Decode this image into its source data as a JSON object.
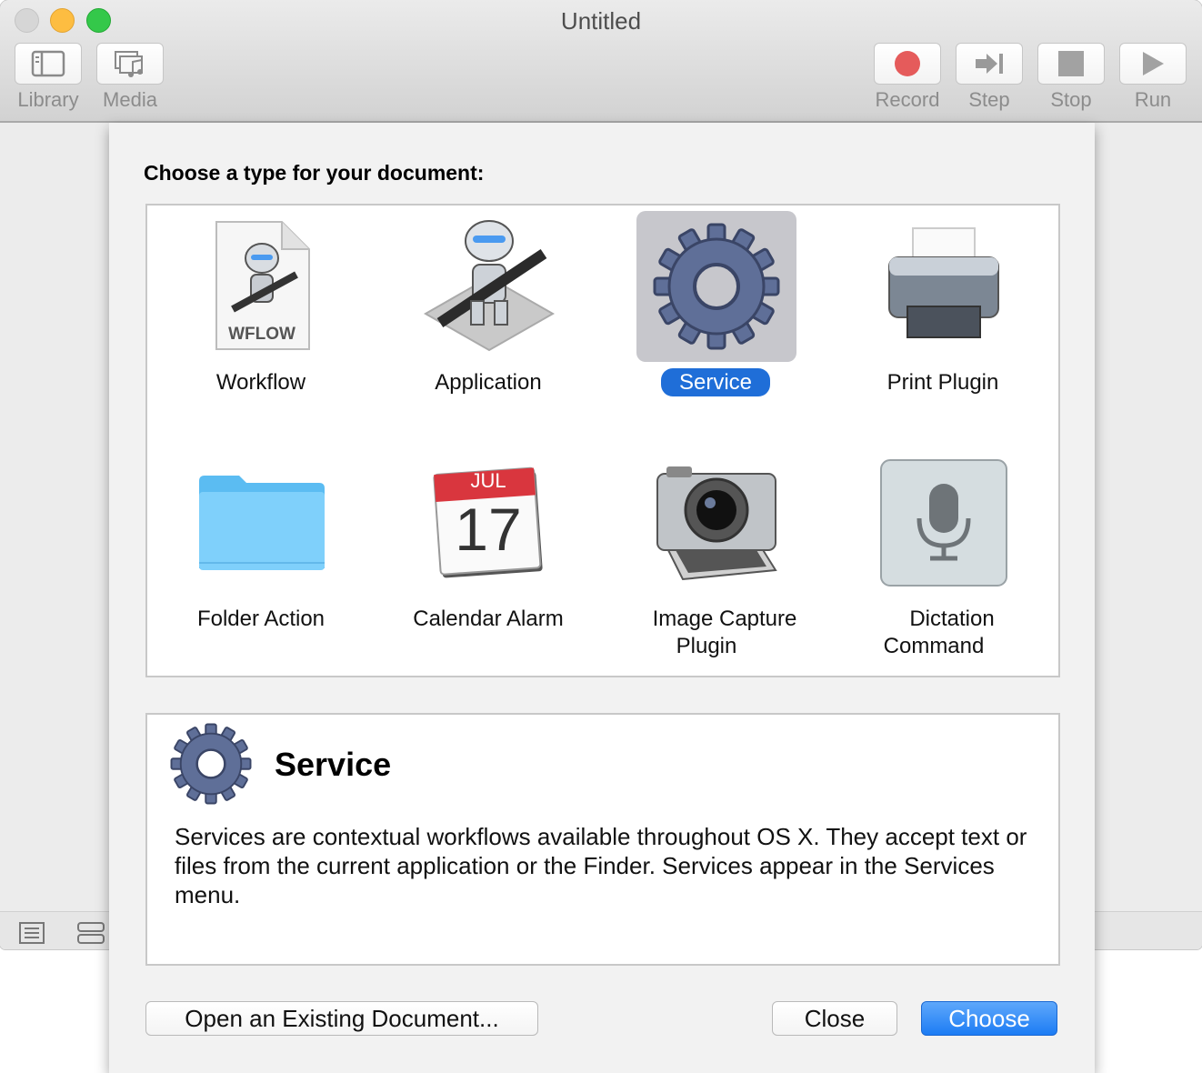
{
  "window": {
    "title": "Untitled"
  },
  "toolbar": {
    "library": "Library",
    "media": "Media",
    "record": "Record",
    "step": "Step",
    "stop": "Stop",
    "run": "Run"
  },
  "sheet": {
    "heading": "Choose a type for your document:",
    "types": [
      {
        "label": "Workflow",
        "icon": "workflow-document-icon",
        "badge": "WFLOW"
      },
      {
        "label": "Application",
        "icon": "automator-robot-icon"
      },
      {
        "label": "Service",
        "icon": "gear-icon",
        "selected": true
      },
      {
        "label": "Print Plugin",
        "icon": "printer-icon"
      },
      {
        "label": "Folder Action",
        "icon": "folder-icon"
      },
      {
        "label": "Calendar Alarm",
        "icon": "calendar-icon",
        "month": "JUL",
        "day": "17"
      },
      {
        "label": "Image Capture\nPlugin",
        "icon": "camera-icon"
      },
      {
        "label": "Dictation\nCommand",
        "icon": "microphone-icon"
      }
    ],
    "description": {
      "title": "Service",
      "text": "Services are contextual workflows available throughout OS X. They accept text or files from the current application or the Finder. Services appear in the Services menu."
    },
    "buttons": {
      "open_existing": "Open an Existing Document...",
      "close": "Close",
      "choose": "Choose"
    }
  },
  "colors": {
    "selection": "#1f6ed8",
    "primary_button": "#1c7cf4",
    "record_dot": "#e55b5b"
  }
}
